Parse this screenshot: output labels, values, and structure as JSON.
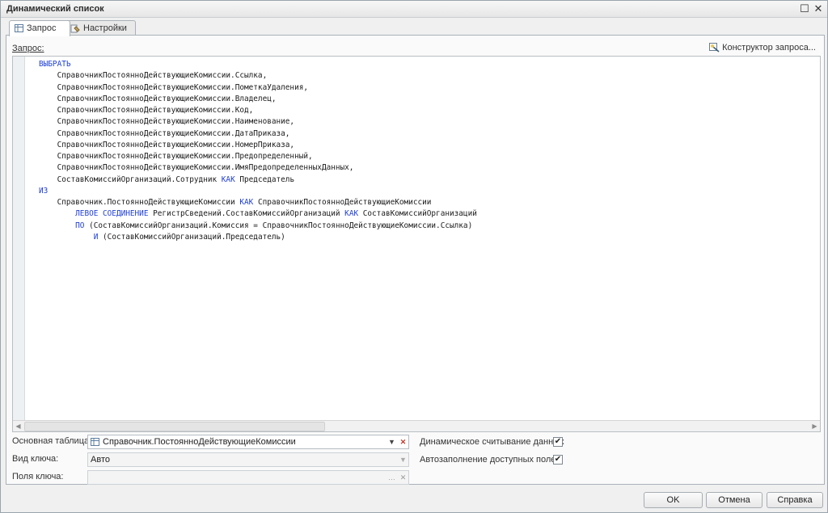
{
  "window": {
    "title": "Динамический список"
  },
  "tabs": [
    {
      "label": "Запрос"
    },
    {
      "label": "Настройки"
    }
  ],
  "query": {
    "label": "Запрос:",
    "constructor_label": "Конструктор запроса...",
    "lines": [
      "ВЫБРАТЬ",
      "    СправочникПостоянноДействующиеКомиссии.Ссылка,",
      "    СправочникПостоянноДействующиеКомиссии.ПометкаУдаления,",
      "    СправочникПостоянноДействующиеКомиссии.Владелец,",
      "    СправочникПостоянноДействующиеКомиссии.Код,",
      "    СправочникПостоянноДействующиеКомиссии.Наименование,",
      "    СправочникПостоянноДействующиеКомиссии.ДатаПриказа,",
      "    СправочникПостоянноДействующиеКомиссии.НомерПриказа,",
      "    СправочникПостоянноДействующиеКомиссии.Предопределенный,",
      "    СправочникПостоянноДействующиеКомиссии.ИмяПредопределенныхДанных,",
      "    СоставКомиссийОрганизаций.Сотрудник КАК Председатель",
      "ИЗ",
      "    Справочник.ПостоянноДействующиеКомиссии КАК СправочникПостоянноДействующиеКомиссии",
      "        ЛЕВОЕ СОЕДИНЕНИЕ РегистрСведений.СоставКомиссийОрганизаций КАК СоставКомиссийОрганизаций",
      "        ПО (СоставКомиссийОрганизаций.Комиссия = СправочникПостоянноДействующиеКомиссии.Ссылка)",
      "            И (СоставКомиссийОрганизаций.Председатель)"
    ],
    "keywords": [
      "ЛЕВОЕ СОЕДИНЕНИЕ",
      "ВЫБРАТЬ",
      "КАК",
      "ИЗ",
      "ПО",
      "И"
    ]
  },
  "form": {
    "main_table_label": "Основная таблица:",
    "main_table_value": "Справочник.ПостоянноДействующиеКомиссии",
    "key_type_label": "Вид ключа:",
    "key_type_value": "Авто",
    "key_fields_label": "Поля ключа:",
    "key_fields_value": "",
    "dynamic_read_label": "Динамическое считывание данных",
    "dynamic_read_checked": true,
    "autofill_label": "Автозаполнение доступных полей",
    "autofill_checked": true
  },
  "buttons": {
    "ok": "OK",
    "cancel": "Отмена",
    "help": "Справка"
  },
  "colors": {
    "keyword": "#1f3fd6"
  }
}
